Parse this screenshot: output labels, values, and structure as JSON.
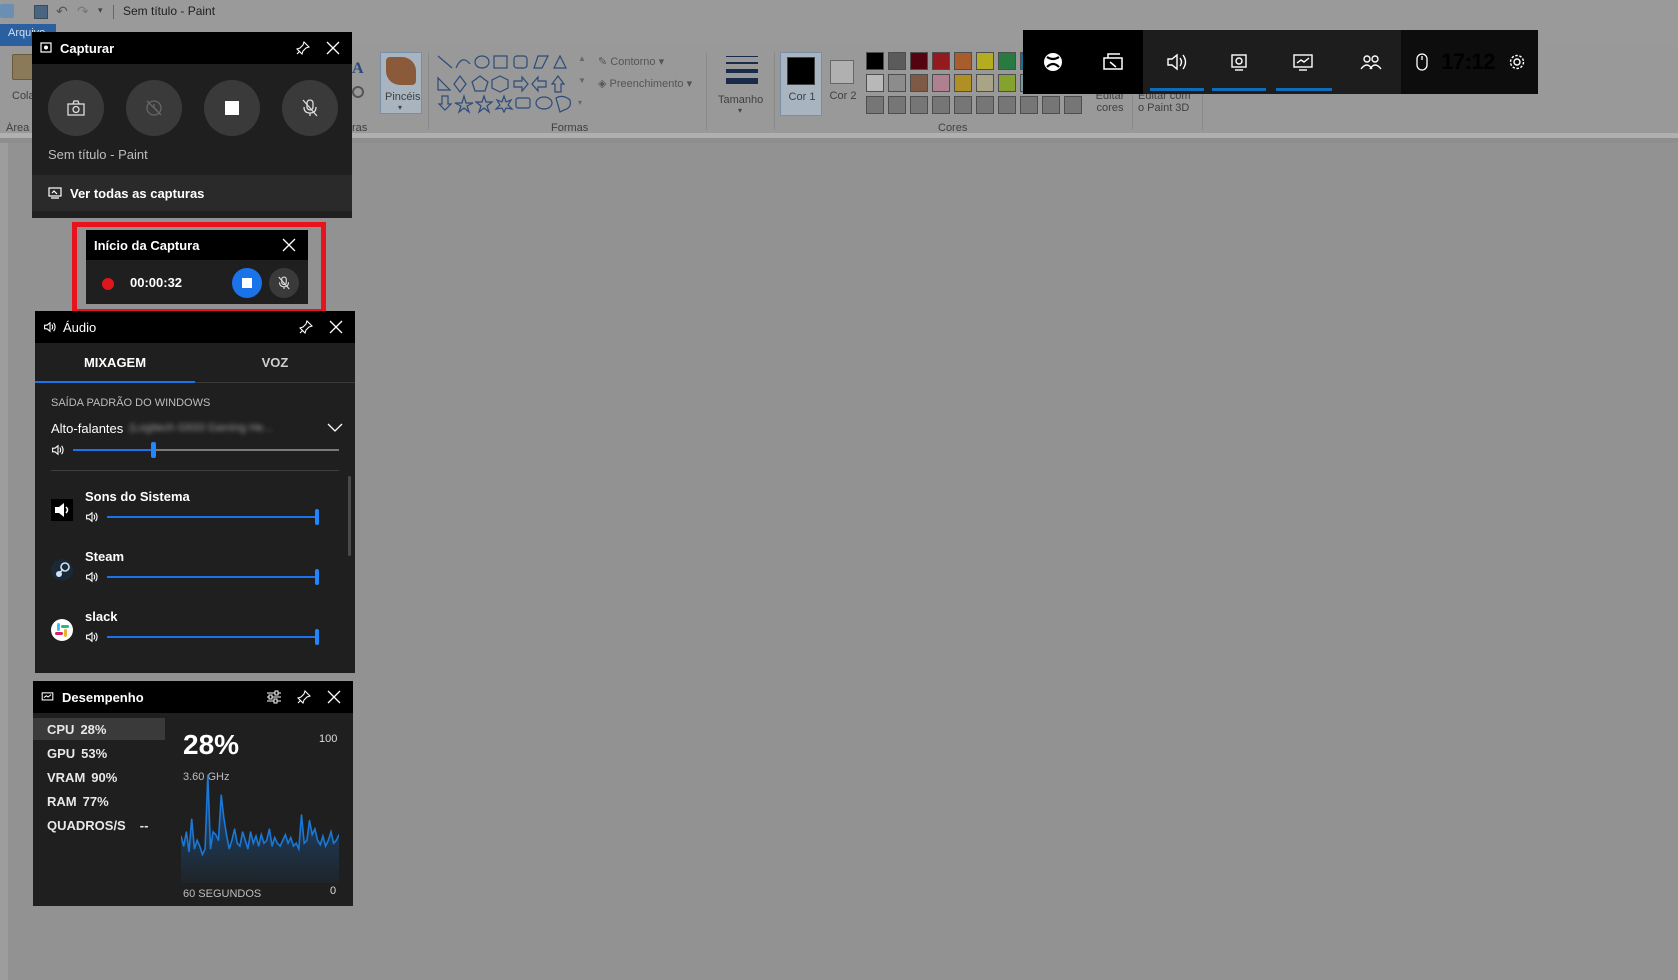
{
  "paint": {
    "window_title": "Sem título - Paint",
    "tab_file": "Arquivo",
    "ribbon": {
      "paste_label": "Colar",
      "area_label": "Área",
      "brushes_label": "Pincéis",
      "outline_label": "Contorno",
      "fill_label": "Preenchimento",
      "shapes_group": "Formas",
      "size_label": "Tamanho",
      "color1_label": "Cor 1",
      "color2_label": "Cor 2",
      "colors_group": "Cores",
      "edit_colors_label": "Editar cores",
      "paint3d_label": "Editar com o Paint 3D",
      "tools_fragment": "ras"
    },
    "palette_row1": [
      "#000000",
      "#7f7f7f",
      "#880015",
      "#ed1c24",
      "#ff7f27",
      "#fff200",
      "#22b14c",
      "#00a2e8"
    ],
    "palette_row2": [
      "#ffffff",
      "#c3c3c3",
      "#b97a57",
      "#ffaec9",
      "#ffc90e",
      "#efe4b0",
      "#b5e61d",
      "#99d9ea"
    ]
  },
  "topbar": {
    "time": "17:12",
    "icons": [
      "xbox-icon",
      "widget-menu-icon",
      "audio-icon",
      "capture-icon",
      "performance-icon",
      "social-icon",
      "mouse-icon",
      "settings-icon"
    ]
  },
  "capture": {
    "title": "Capturar",
    "app_name": "Sem título - Paint",
    "see_all": "Ver todas as capturas"
  },
  "recording": {
    "title": "Início da Captura",
    "timer": "00:00:32",
    "highlight_color": "#e8131c"
  },
  "audio": {
    "title": "Áudio",
    "tabs": [
      "MIXAGEM",
      "VOZ"
    ],
    "active_tab": "MIXAGEM",
    "section_label": "SAÍDA PADRÃO DO WINDOWS",
    "device_name": "Alto-falantes",
    "device_detail": "(Logitech G933 Gaming He...",
    "master_volume": 0.3,
    "apps": [
      {
        "name": "Sons do Sistema",
        "volume": 1.0
      },
      {
        "name": "Steam",
        "volume": 1.0
      },
      {
        "name": "slack",
        "volume": 1.0
      }
    ]
  },
  "performance": {
    "title": "Desempenho",
    "metrics": [
      {
        "label": "CPU",
        "value": "28%"
      },
      {
        "label": "GPU",
        "value": "53%"
      },
      {
        "label": "VRAM",
        "value": "90%"
      },
      {
        "label": "RAM",
        "value": "77%"
      },
      {
        "label": "QUADROS/S",
        "value": "--"
      }
    ],
    "big_value": "28%",
    "frequency": "3.60 GHz",
    "y_max": "100",
    "y_min": "0",
    "x_label": "60 SEGUNDOS"
  },
  "chart_data": {
    "type": "area",
    "title": "",
    "xlabel": "60 SEGUNDOS",
    "ylabel": "",
    "ylim": [
      0,
      100
    ],
    "x": [
      0,
      1,
      2,
      3,
      4,
      5,
      6,
      7,
      8,
      9,
      10,
      11,
      12,
      13,
      14,
      15,
      16,
      17,
      18,
      19,
      20,
      21,
      22,
      23,
      24,
      25,
      26,
      27,
      28,
      29,
      30,
      31,
      32,
      33,
      34,
      35,
      36,
      37,
      38,
      39,
      40,
      41,
      42,
      43,
      44,
      45,
      46,
      47,
      48,
      49,
      50,
      51,
      52,
      53,
      54,
      55,
      56,
      57,
      58,
      59
    ],
    "series": [
      {
        "values": [
          33,
          26,
          36,
          22,
          45,
          24,
          30,
          26,
          20,
          24,
          76,
          24,
          36,
          34,
          30,
          62,
          46,
          34,
          24,
          30,
          38,
          28,
          26,
          36,
          30,
          24,
          36,
          28,
          33,
          26,
          34,
          28,
          30,
          38,
          26,
          32,
          28,
          26,
          30,
          34,
          28,
          32,
          26,
          28,
          24,
          48,
          28,
          30,
          44,
          34,
          38,
          30,
          27,
          33,
          26,
          30,
          36,
          28,
          30,
          34
        ]
      }
    ],
    "color": "#1a78d6"
  }
}
